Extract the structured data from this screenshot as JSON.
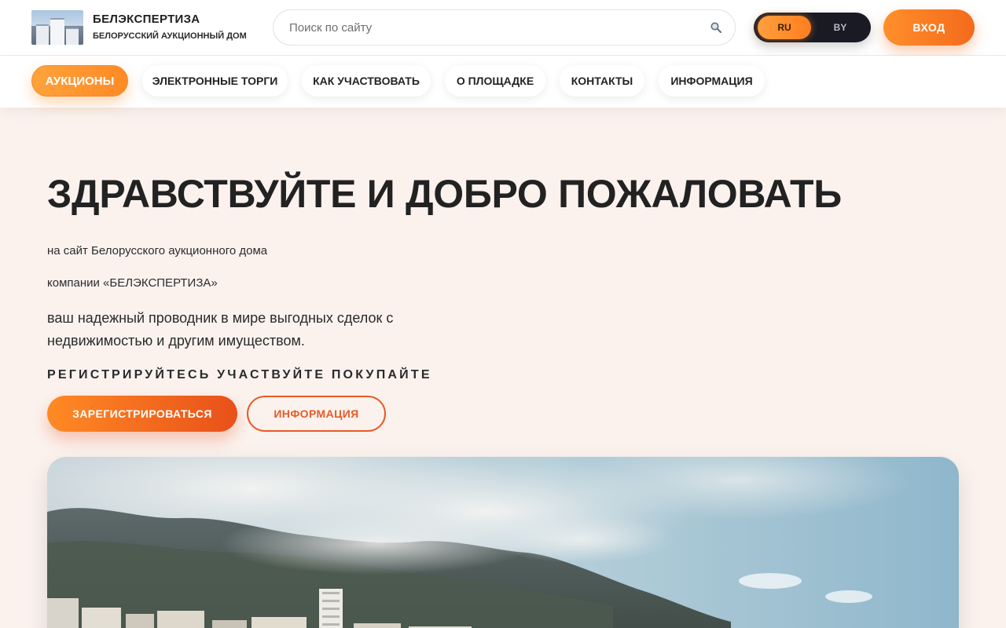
{
  "header": {
    "brand_title": "БЕЛЭКСПЕРТИЗА",
    "brand_subtitle": "БЕЛОРУССКИЙ АУКЦИОННЫЙ ДОМ",
    "search_placeholder": "Поиск по сайту",
    "search_icon": "magnifier-icon",
    "languages": [
      {
        "code": "RU",
        "active": true
      },
      {
        "code": "BY",
        "active": false
      }
    ],
    "login_label": "ВХОД"
  },
  "nav": {
    "items": [
      {
        "label": "АУКЦИОНЫ",
        "active": true
      },
      {
        "label": "ЭЛЕКТРОННЫЕ ТОРГИ",
        "active": false
      },
      {
        "label": "КАК УЧАСТВОВАТЬ",
        "active": false
      },
      {
        "label": "О ПЛОЩАДКЕ",
        "active": false
      },
      {
        "label": "КОНТАКТЫ",
        "active": false
      },
      {
        "label": "ИНФОРМАЦИЯ",
        "active": false
      }
    ]
  },
  "hero": {
    "title": "ЗДРАВСТВУЙТЕ И ДОБРО ПОЖАЛОВАТЬ",
    "line1": "на сайт Белорусского аукционного дома",
    "line2": "компании «БЕЛЭКСПЕРТИЗА»",
    "description": "ваш надежный проводник в мире выгодных сделок с недвижимостью и другим имуществом.",
    "tagline": "РЕГИСТРИРУЙТЕСЬ УЧАСТВУЙТЕ ПОКУПАЙТЕ",
    "register_label": "ЗАРЕГИСТРИРОВАТЬСЯ",
    "info_label": "ИНФОРМАЦИЯ"
  },
  "colors": {
    "accent": "#ff8a24",
    "accent_dark": "#e8501a",
    "page_bg": "#fbf2ee",
    "text": "#222222"
  }
}
